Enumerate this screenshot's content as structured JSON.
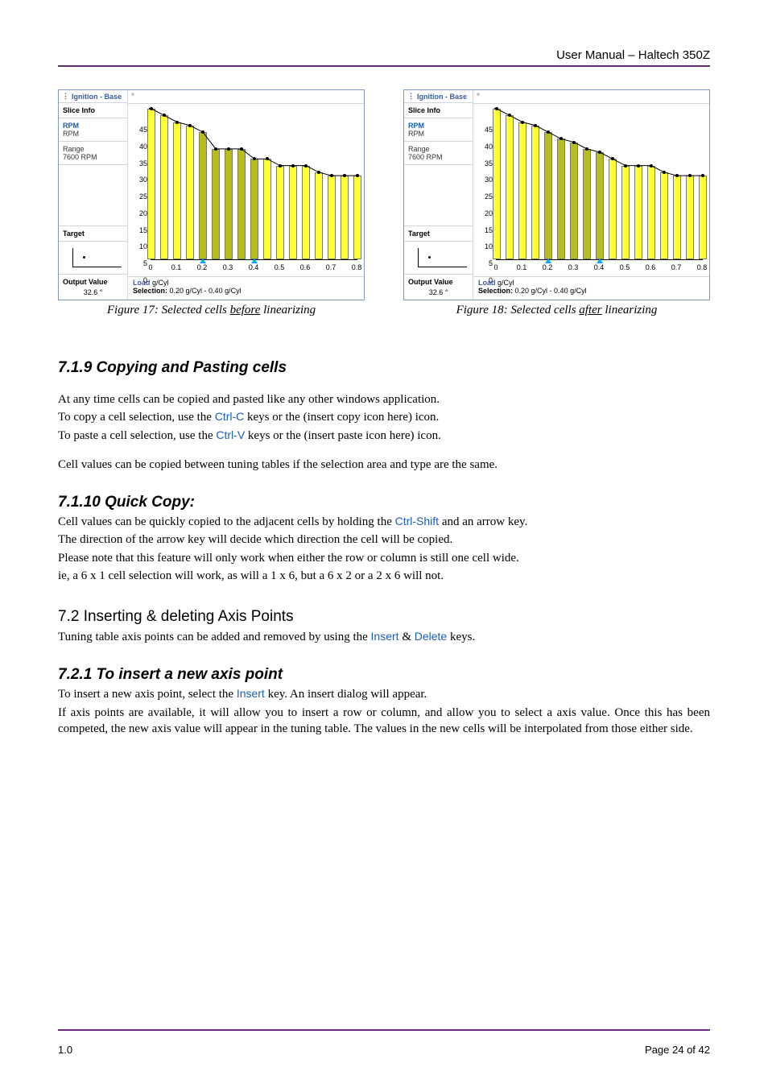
{
  "header": {
    "right": "User Manual – Haltech 350Z"
  },
  "chart_data": [
    {
      "type": "bar",
      "title": "Ignition - Base",
      "x": [
        0,
        0.05,
        0.1,
        0.15,
        0.2,
        0.25,
        0.3,
        0.35,
        0.4,
        0.45,
        0.5,
        0.55,
        0.6,
        0.65,
        0.7,
        0.75,
        0.8
      ],
      "values": [
        45,
        43,
        41,
        40,
        38,
        33,
        33,
        33,
        30,
        30,
        28,
        28,
        28,
        26,
        25,
        25,
        25
      ],
      "selection": [
        0.2,
        0.4
      ],
      "xlabel": "Load g/Cyl",
      "xlim": [
        0,
        0.8
      ],
      "ylim": [
        0,
        45
      ],
      "yticks": [
        0,
        5,
        10,
        15,
        20,
        25,
        30,
        35,
        40,
        45
      ],
      "xticks": [
        0,
        0.1,
        0.2,
        0.3,
        0.4,
        0.5,
        0.6,
        0.7,
        0.8
      ],
      "selection_text": "0.20 g/Cyl - 0.40 g/Cyl",
      "side": {
        "slice_info": "Slice Info",
        "rpm_lab": "RPM",
        "rpm_sub": "RPM",
        "range_lab": "Range",
        "range_val": "7600 RPM",
        "target": "Target",
        "output": "Output Value",
        "output_val": "32.6 °"
      }
    },
    {
      "type": "bar",
      "title": "Ignition - Base",
      "x": [
        0,
        0.05,
        0.1,
        0.15,
        0.2,
        0.25,
        0.3,
        0.35,
        0.4,
        0.45,
        0.5,
        0.55,
        0.6,
        0.65,
        0.7,
        0.75,
        0.8
      ],
      "values": [
        45,
        43,
        41,
        40,
        38,
        36,
        35,
        33,
        32,
        30,
        28,
        28,
        28,
        26,
        25,
        25,
        25
      ],
      "selection": [
        0.2,
        0.4
      ],
      "xlabel": "Load g/Cyl",
      "xlim": [
        0,
        0.8
      ],
      "ylim": [
        0,
        45
      ],
      "yticks": [
        0,
        5,
        10,
        15,
        20,
        25,
        30,
        35,
        40,
        45
      ],
      "xticks": [
        0,
        0.1,
        0.2,
        0.3,
        0.4,
        0.5,
        0.6,
        0.7,
        0.8
      ],
      "selection_text": "0.20 g/Cyl - 0.40 g/Cyl",
      "side": {
        "slice_info": "Slice Info",
        "rpm_lab": "RPM",
        "rpm_sub": "RPM",
        "range_lab": "Range",
        "range_val": "7600 RPM",
        "target": "Target",
        "output": "Output Value",
        "output_val": "32.6 °"
      }
    }
  ],
  "captions": {
    "f17_pre": "Figure 17: Selected cells ",
    "f17_u": "before",
    "f17_post": " linearizing",
    "f18_pre": "Figure 18: Selected cells ",
    "f18_u": "after",
    "f18_post": " linearizing"
  },
  "s719": {
    "h": "7.1.9 Copying and Pasting cells",
    "p1": "At any time cells can be copied and pasted like any other windows application.",
    "p2a": "To copy a cell selection, use the ",
    "p2k": "Ctrl-C",
    "p2b": " keys or the (insert copy icon here) icon.",
    "p3a": "To paste a cell selection, use the ",
    "p3k": "Ctrl-V",
    "p3b": " keys or the (insert paste icon here) icon.",
    "p4": "Cell values can be copied between tuning tables if the selection area and type are the same."
  },
  "s7110": {
    "h": "7.1.10       Quick Copy:",
    "p1a": "Cell values can be quickly copied to the adjacent cells by holding the ",
    "p1k": "Ctrl-Shift",
    "p1b": " and an arrow key.",
    "p2": "The direction of the arrow key will decide which direction the cell will be copied.",
    "p3": "Please note that this feature will only work when either the row or column is still one cell wide.",
    "p4": "ie, a 6 x 1 cell selection will work, as will a 1 x 6, but a  6 x 2 or a 2 x 6  will not."
  },
  "s72": {
    "h": "7.2    Inserting & deleting Axis Points",
    "p1a": "Tuning table axis points can be added and removed by using the ",
    "p1k1": "Insert",
    "p1amp": " & ",
    "p1k2": "Delete",
    "p1b": " keys."
  },
  "s721": {
    "h": "7.2.1 To insert a new axis point",
    "p1a": "To insert a new axis point, select the ",
    "p1k": "Insert",
    "p1b": " key. An insert dialog will appear.",
    "p2": "If axis points are available, it will allow you to insert a row or column, and allow you to select a axis value. Once this has been competed, the new axis value will appear in the tuning table. The values in the new cells will be interpolated from those either side."
  },
  "footer": {
    "left": "1.0",
    "right": "Page 24 of 42"
  },
  "legend_labels": {
    "load": "Load",
    "sel": "Selection:"
  }
}
